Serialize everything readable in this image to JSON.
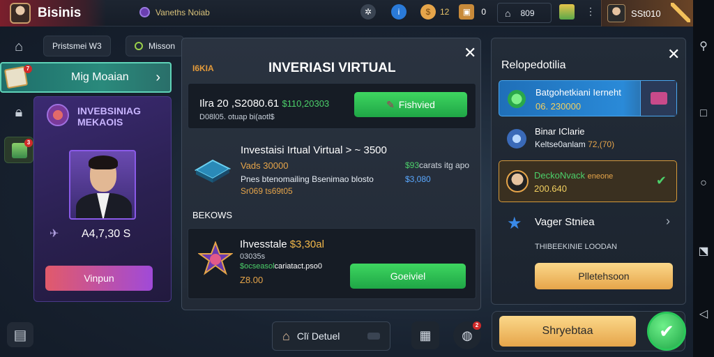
{
  "topbar": {
    "brand": "Bisinis",
    "project": "Vaneths Noiab",
    "coins": "12",
    "gems": "0",
    "home_value": "809",
    "profile_name": "SSt010"
  },
  "left": {
    "tab1": "Pristsmei W3",
    "tab2": "Misson",
    "nav_label": "Mig Moaian",
    "nav_badge": "7",
    "card_title_line1": "INVEBSINIAG",
    "card_title_line2": "MEKAOIS",
    "card_amount": "A4,7,30 S",
    "card_button": "Vinpun",
    "rail_badge": "3"
  },
  "modal": {
    "tag": "I6KIA",
    "title": "INVERIASI VIRTUAL",
    "row1_main": "Ilra 20 ,S2080.61",
    "row1_green": "$110,20303",
    "row1_sub": "D08l05. otuap bi(aotl$",
    "row1_button": "Fishvied",
    "row2_title": "Investaisi Irtual Virtual >  ~  3500",
    "row2_orange": "Vads 30000",
    "row2_right_green": "$93",
    "row2_right_rest": "carats itg apo",
    "row2_desc": "Pnes btenomailing Bsenimao blosto",
    "row2_right_blue": "$3,080",
    "row2_bottom": "Sr069 ts69t05",
    "section_label": "BEKOWS",
    "row3_title": "Ihvesstale",
    "row3_title_orange": "$3,30al",
    "row3_sub": "03035s",
    "row3_green": "$ocseasol",
    "row3_rest": "cariatact.pso0",
    "row3_amount": "Z8.00",
    "row3_button": "Goeiviel"
  },
  "dock": {
    "label": "Clï Detuel",
    "badge": "2"
  },
  "right": {
    "title": "Relopedotilia",
    "item1_a": "Batgohetkiani Ierneht",
    "item1_b": "06. 230000",
    "item2_a": "Binar IClarie",
    "item2_b": "Keltse0anlam",
    "item2_b_orange": "72,(70)",
    "item3_a": "DeckoNvack",
    "item3_a_orange": "eneone",
    "item3_b": "200.640",
    "item4_a": "Vager Stniea",
    "caption": "THIBEEKINIE LOODAN",
    "button": "Plletehsoon",
    "cta": "Shryebtaa"
  },
  "colors": {
    "accent_green": "#3ed660",
    "accent_gold": "#e6a54a",
    "accent_blue": "#2a8ad8",
    "accent_purple": "#a04ad8"
  }
}
